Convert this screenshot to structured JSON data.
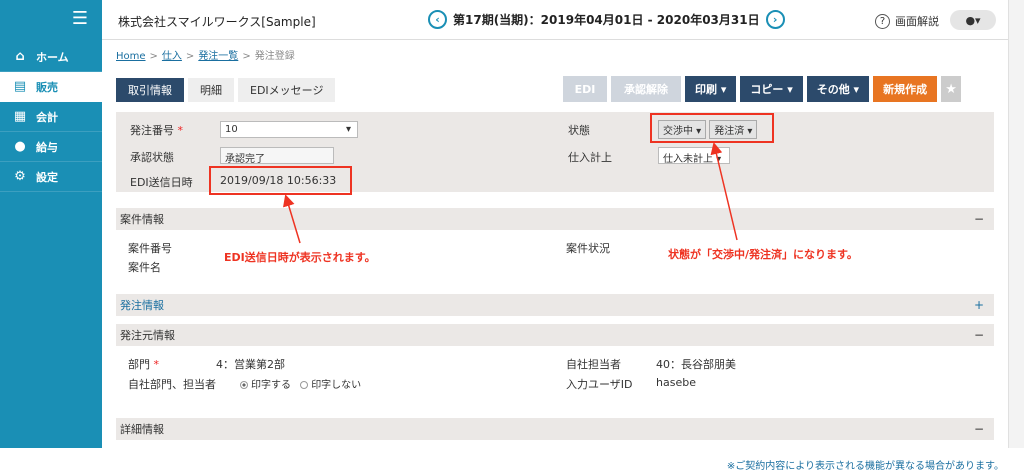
{
  "sidebar": {
    "items": [
      {
        "label": "ホーム",
        "icon": "home-icon",
        "glyph": "⌂"
      },
      {
        "label": "販売",
        "icon": "cart-icon",
        "glyph": "🛒"
      },
      {
        "label": "会計",
        "icon": "calculator-icon",
        "glyph": "▦"
      },
      {
        "label": "給与",
        "icon": "moneybag-icon",
        "glyph": "💰"
      },
      {
        "label": "設定",
        "icon": "gear-icon",
        "glyph": "⚙"
      }
    ]
  },
  "header": {
    "company": "株式会社スマイルワークス[Sample]",
    "period": "第17期(当期)：2019年04月01日 - 2020年03月31日",
    "help": "画面解説"
  },
  "breadcrumb": {
    "home": "Home",
    "purchase": "仕入",
    "order_list": "発注一覧",
    "current": "発注登録"
  },
  "tabs": [
    "取引情報",
    "明細",
    "EDIメッセージ"
  ],
  "actions": {
    "edi": "EDI",
    "unapprove": "承認解除",
    "print": "印刷 ▾",
    "copy": "コピー ▾",
    "other": "その他 ▾",
    "new": "新規作成"
  },
  "form": {
    "order_no_label": "発注番号",
    "order_no": "10",
    "approval_label": "承認状態",
    "approval": "承認完了",
    "edi_sent_label": "EDI送信日時",
    "edi_sent": "2019/09/18 10:56:33",
    "status_label": "状態",
    "status1": "交渉中",
    "status2": "発注済",
    "purchase_label": "仕入計上",
    "purchase": "仕入未計上"
  },
  "sections": {
    "project": {
      "title": "案件情報",
      "toggle": "−",
      "no_label": "案件番号",
      "name_label": "案件名",
      "status_label": "案件状況"
    },
    "order_info": {
      "title": "発注情報",
      "toggle": "+"
    },
    "orderer": {
      "title": "発注元情報",
      "toggle": "−",
      "dept_label": "部門",
      "dept": "4：営業第2部",
      "print_label": "自社部門、担当者",
      "print_yes": "印字する",
      "print_no": "印字しない",
      "staff_label": "自社担当者",
      "staff": "40：長谷部朋美",
      "input_user_label": "入力ユーザID",
      "input_user": "hasebe"
    },
    "detail": {
      "title": "詳細情報",
      "toggle": "−"
    }
  },
  "notes": {
    "edi": "EDI送信日時が表示されます。",
    "status": "状態が「交渉中/発注済」になります。"
  },
  "footnote": "※ご契約内容により表示される機能が異なる場合があります。",
  "colors": {
    "sidebar": "#1a8fb5",
    "primary": "#2c4a6b",
    "accent": "#e87522",
    "annotation": "#e32222"
  }
}
